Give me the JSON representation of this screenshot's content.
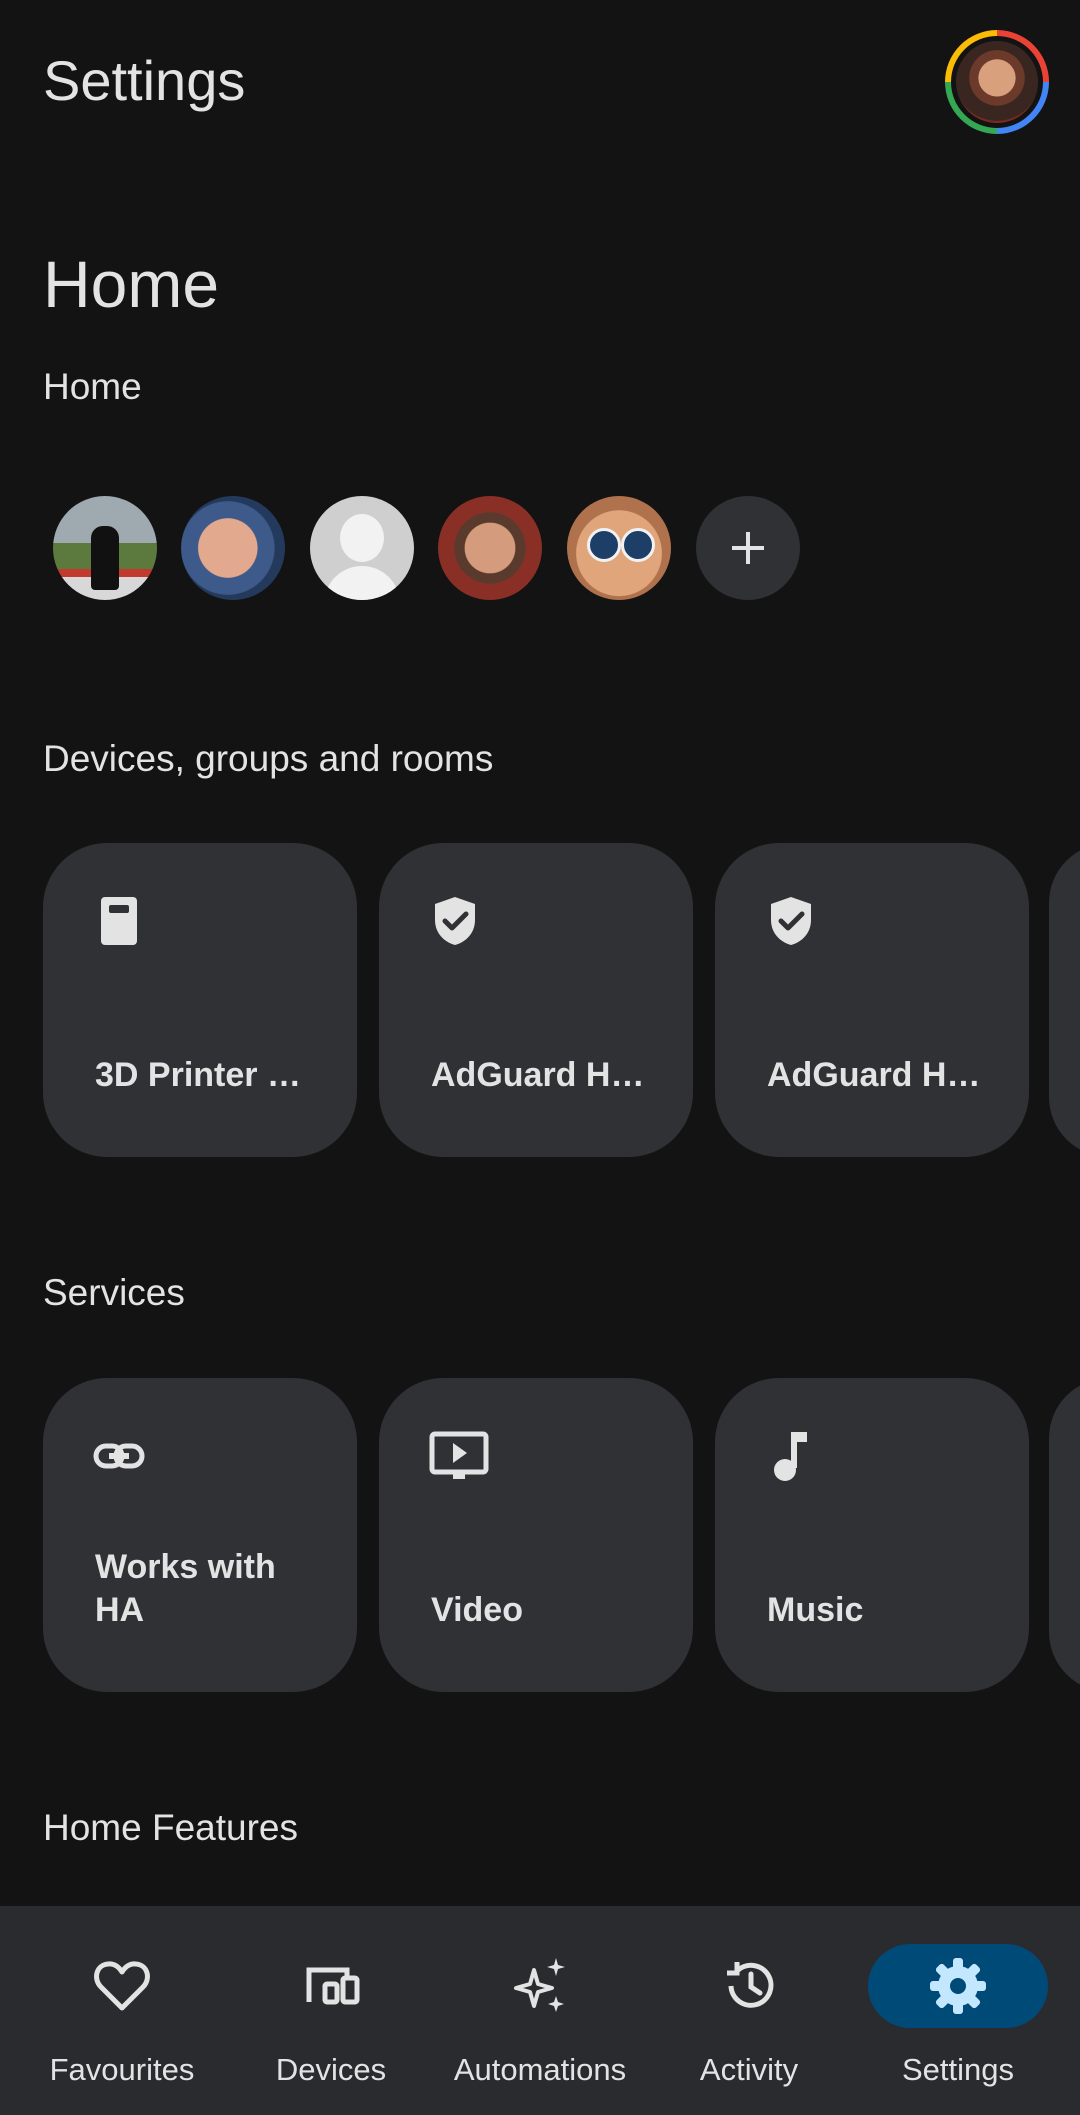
{
  "header": {
    "title": "Settings"
  },
  "home": {
    "heading": "Home",
    "name": "Home"
  },
  "sections": {
    "devices": "Devices, groups and rooms",
    "services": "Services",
    "features": "Home Features"
  },
  "device_cards": [
    {
      "label": "3D Printer …",
      "icon": "tablet-icon"
    },
    {
      "label": "AdGuard H…",
      "icon": "shield-check-icon"
    },
    {
      "label": "AdGuard H…",
      "icon": "shield-check-icon"
    }
  ],
  "service_cards": [
    {
      "label": "Works with HA",
      "icon": "link-icon"
    },
    {
      "label": "Video",
      "icon": "video-play-icon"
    },
    {
      "label": "Music",
      "icon": "music-note-icon"
    }
  ],
  "nav": [
    {
      "label": "Favourites",
      "icon": "heart-icon",
      "active": false
    },
    {
      "label": "Devices",
      "icon": "devices-icon",
      "active": false
    },
    {
      "label": "Automations",
      "icon": "sparkle-icon",
      "active": false
    },
    {
      "label": "Activity",
      "icon": "history-icon",
      "active": false
    },
    {
      "label": "Settings",
      "icon": "gear-icon",
      "active": true
    }
  ],
  "colors": {
    "background": "#131314",
    "card": "#303134",
    "nav_background": "#2a2b2e",
    "active_pill": "#004a77",
    "active_icon": "#c2e7ff"
  }
}
